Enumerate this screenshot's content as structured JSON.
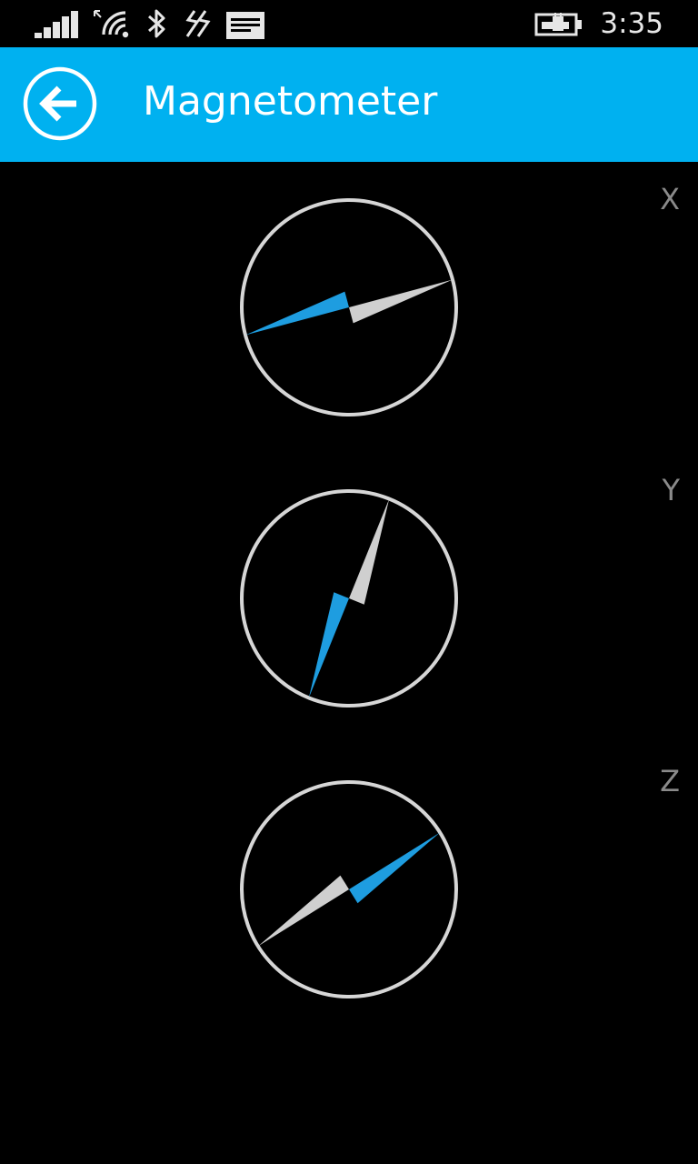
{
  "status_bar": {
    "time": "3:35",
    "icons": [
      "signal-icon",
      "wifi-icon",
      "bluetooth-icon",
      "nfc-icon",
      "message-icon",
      "battery-charging-icon"
    ]
  },
  "header": {
    "title": "Magnetometer",
    "back_icon": "back-arrow-icon",
    "background": "#00b1f0"
  },
  "compasses": [
    {
      "axis": "X",
      "needle_angle_deg": 75
    },
    {
      "axis": "Y",
      "needle_angle_deg": 22
    },
    {
      "axis": "Z",
      "needle_angle_deg": 58
    }
  ],
  "colors": {
    "needle_north": "#1e9de0",
    "needle_south": "#cfcfcf",
    "ring": "#d6d6d6",
    "axis_label": "#8a8a8a"
  }
}
